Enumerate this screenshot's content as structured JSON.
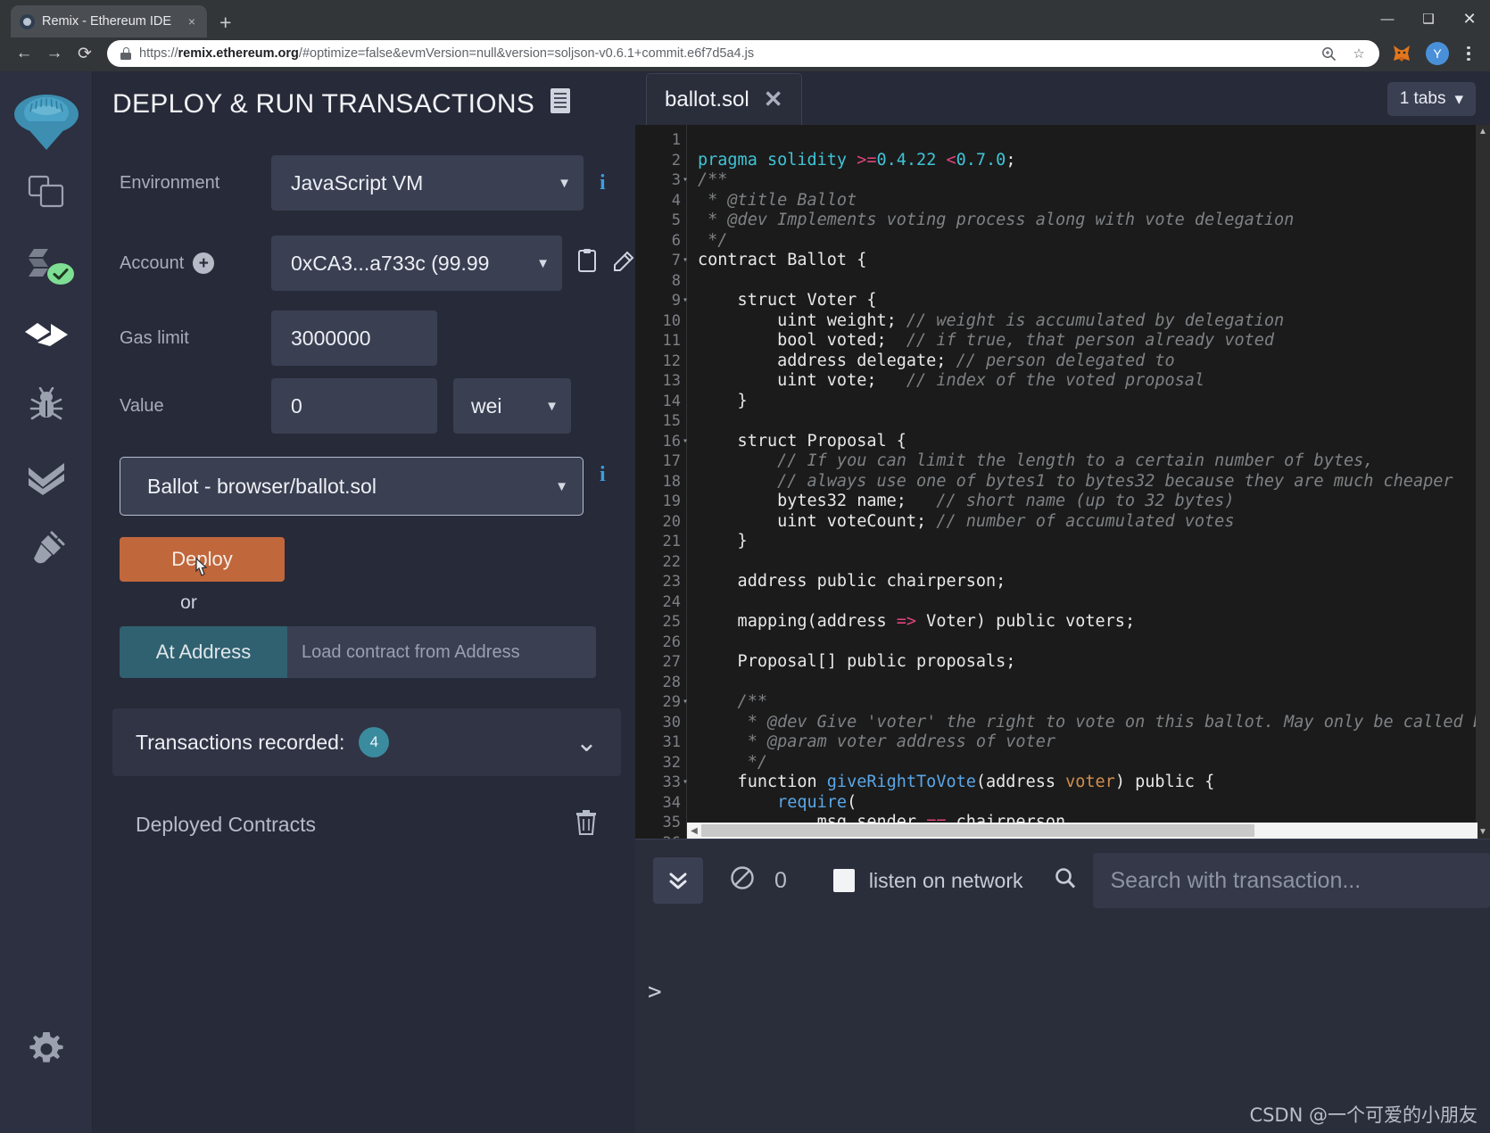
{
  "browser": {
    "tab": {
      "title": "Remix - Ethereum IDE",
      "close": "×",
      "favicon": "remix-favicon"
    },
    "new_tab": "+",
    "window": {
      "minimize": "—",
      "maximize": "❑",
      "close": "✕"
    },
    "nav": {
      "back": "←",
      "forward": "→",
      "reload": "⟳"
    },
    "url": {
      "scheme_host_a": "https://",
      "host_bold": "remix.ethereum.org",
      "path": "/#optimize=false&evmVersion=null&version=soljson-v0.6.1+commit.e6f7d5a4.js",
      "full": "https://remix.ethereum.org/#optimize=false&evmVersion=null&version=soljson-v0.6.1+commit.e6f7d5a4.js"
    },
    "omni_icons": {
      "zoom": "zoom-in-icon",
      "bookmark": "☆"
    },
    "extension": "metamask-fox-icon",
    "profile_initial": "Y",
    "menu": "chrome-menu-icon"
  },
  "rail": {
    "logo": "remix-logo-icon",
    "items": [
      {
        "name": "file-explorers",
        "icon": "copy-files-icon",
        "active": false
      },
      {
        "name": "solidity-compiler",
        "icon": "solidity-compiler-icon",
        "active": false,
        "badge": "check"
      },
      {
        "name": "deploy-and-run-transactions",
        "icon": "deploy-run-icon",
        "active": true
      },
      {
        "name": "debugger",
        "icon": "bug-icon",
        "active": false
      },
      {
        "name": "solidity-static-analysis",
        "icon": "double-check-icon",
        "active": false
      },
      {
        "name": "plugin-manager",
        "icon": "plug-icon",
        "active": false
      }
    ],
    "settings": {
      "name": "settings",
      "icon": "gear-icon"
    }
  },
  "panel": {
    "title": "DEPLOY & RUN TRANSACTIONS",
    "title_icon": "document-icon",
    "environment": {
      "label": "Environment",
      "value": "JavaScript VM",
      "caret": "▼",
      "info_icon": "info-icon"
    },
    "account": {
      "label": "Account",
      "add_icon": "plus-circle-icon",
      "value": "0xCA3...a733c (99.99",
      "caret": "▼",
      "copy_icon": "clipboard-icon",
      "edit_icon": "pencil-icon"
    },
    "gas_limit": {
      "label": "Gas limit",
      "value": "3000000"
    },
    "value_field": {
      "label": "Value",
      "value": "0",
      "unit": "wei",
      "unit_caret": "▼"
    },
    "contract": {
      "value": "Ballot - browser/ballot.sol",
      "caret": "▼",
      "info_icon": "info-icon"
    },
    "deploy_button": "Deploy",
    "or": "or",
    "at_address_button": "At Address",
    "at_address_placeholder": "Load contract from Address",
    "transactions": {
      "label": "Transactions recorded:",
      "count": "4",
      "chevron": "⌄"
    },
    "deployed": {
      "title": "Deployed Contracts",
      "trash_icon": "trash-icon"
    }
  },
  "editor": {
    "tab": {
      "name": "ballot.sol",
      "close": "✕"
    },
    "tabs_pill": {
      "label": "1 tabs",
      "caret": "▾"
    },
    "first_line": 1,
    "last_line": 36,
    "fold_lines": [
      3,
      7,
      9,
      16,
      29,
      33
    ],
    "lines": [
      "",
      "pragma solidity >=0.4.22 <0.7.0;",
      "/**",
      " * @title Ballot",
      " * @dev Implements voting process along with vote delegation",
      " */",
      "contract Ballot {",
      "",
      "    struct Voter {",
      "        uint weight; // weight is accumulated by delegation",
      "        bool voted;  // if true, that person already voted",
      "        address delegate; // person delegated to",
      "        uint vote;   // index of the voted proposal",
      "    }",
      "",
      "    struct Proposal {",
      "        // If you can limit the length to a certain number of bytes,",
      "        // always use one of bytes1 to bytes32 because they are much cheaper",
      "        bytes32 name;   // short name (up to 32 bytes)",
      "        uint voteCount; // number of accumulated votes",
      "    }",
      "",
      "    address public chairperson;",
      "",
      "    mapping(address => Voter) public voters;",
      "",
      "    Proposal[] public proposals;",
      "",
      "    /**",
      "     * @dev Give 'voter' the right to vote on this ballot. May only be called by 'chairperson'.",
      "     * @param voter address of voter",
      "     */",
      "    function giveRightToVote(address voter) public {",
      "        require(",
      "            msg.sender == chairperson,"
    ]
  },
  "terminal": {
    "toggle_icon": "chevrons-down-icon",
    "clear_icon": "ban-icon",
    "pending_count": "0",
    "listen_checkbox": "listen-checkbox",
    "listen_label": "listen on network",
    "search_icon": "search-icon",
    "search_placeholder": "Search with transaction...",
    "prompt": ">"
  },
  "watermark": "CSDN @一个可爱的小朋友"
}
